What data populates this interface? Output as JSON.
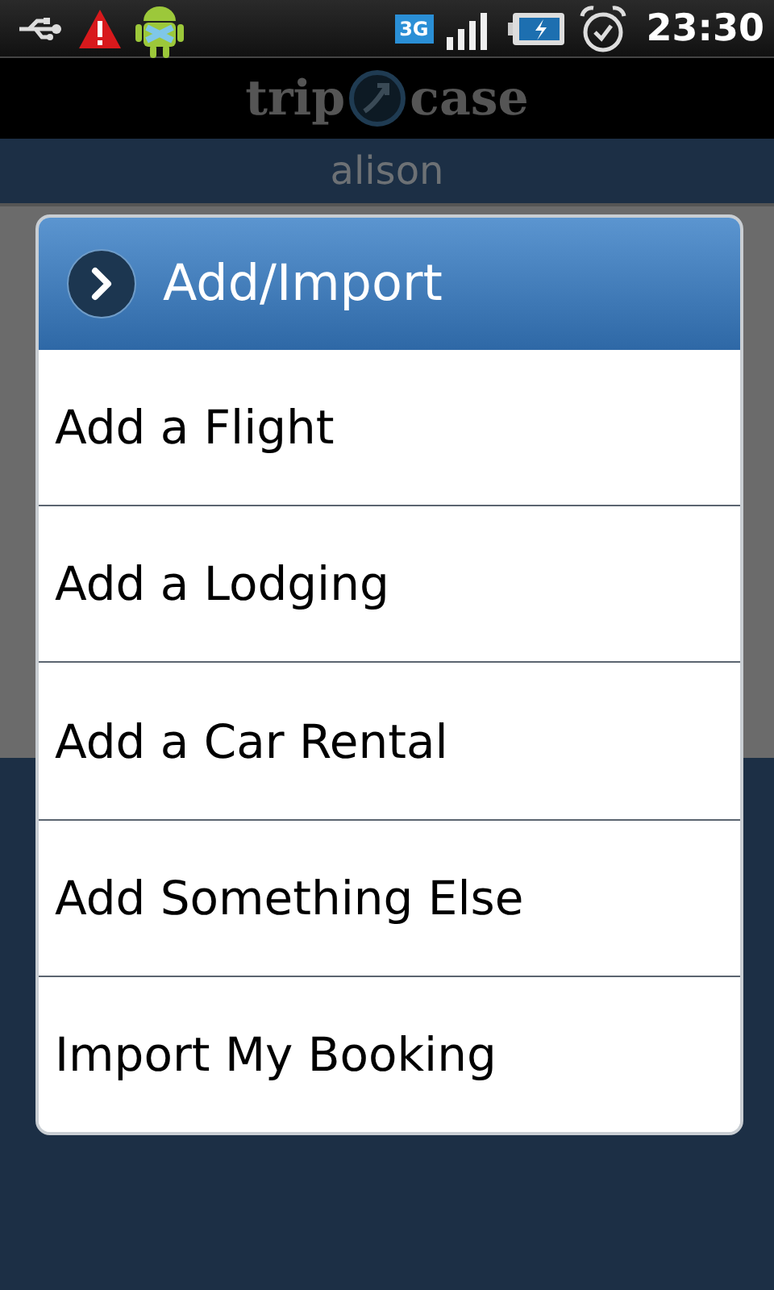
{
  "status_bar": {
    "network": "3G",
    "time": "23:30"
  },
  "header": {
    "logo_left": "trip",
    "logo_right": "case"
  },
  "user_bar": {
    "name": "alison"
  },
  "dialog": {
    "title": "Add/Import",
    "items": [
      {
        "label": "Add a Flight"
      },
      {
        "label": "Add a Lodging"
      },
      {
        "label": "Add a Car Rental"
      },
      {
        "label": "Add Something Else"
      },
      {
        "label": "Import My Booking"
      }
    ]
  }
}
